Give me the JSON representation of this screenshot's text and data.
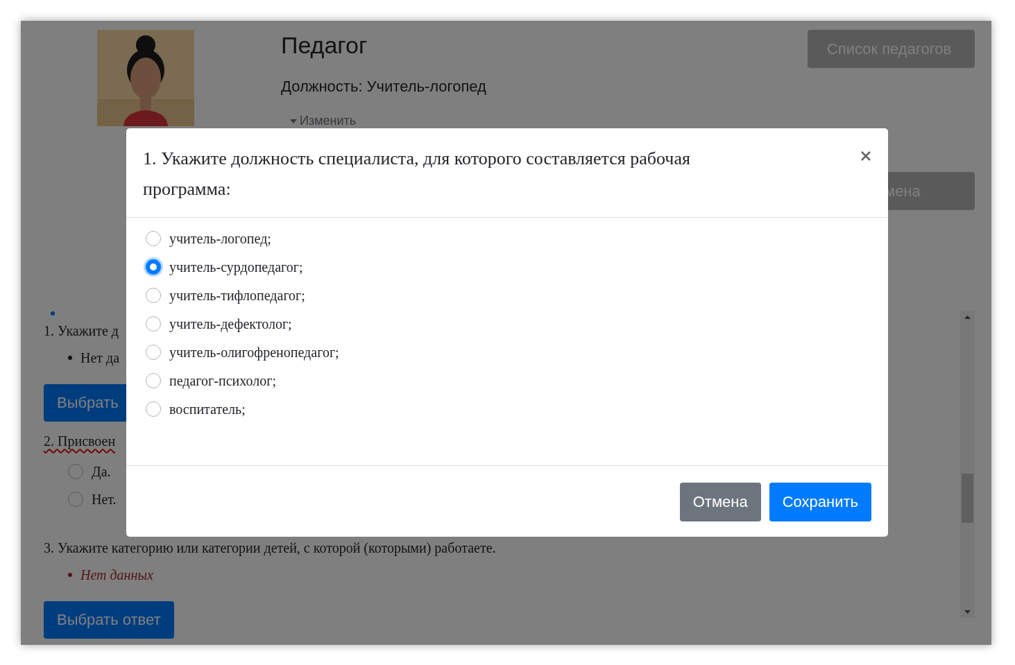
{
  "profile": {
    "kind": "picture",
    "title": "Педагог",
    "position": "Должность: Учитель-логопед",
    "toggle": {
      "label": "Изменить",
      "expanded": false
    }
  },
  "side_buttons": [
    {
      "label": "Список педагогов"
    },
    {
      "label": "мена"
    }
  ],
  "questions": [
    {
      "kind": "list",
      "title": "1. Укажите д",
      "flagged": false,
      "items": [
        {
          "text": "Нет да",
          "missing": false
        }
      ],
      "button": "Выбрать"
    },
    {
      "kind": "radio",
      "title": "2. Присвоен",
      "flagged": true,
      "options": [
        {
          "label": "Да.",
          "selected": false
        },
        {
          "label": "Нет.",
          "selected": false
        }
      ]
    },
    {
      "kind": "list",
      "title": "3. Укажите категорию или категории детей, с которой (которыми) работаете.",
      "flagged": false,
      "items": [
        {
          "text": "Нет данных",
          "missing": true
        }
      ],
      "button": "Выбрать ответ"
    }
  ],
  "modal": {
    "title": "1. Укажите должность специалиста, для которого составляется рабочая программа:",
    "options": [
      {
        "label": "учитель-логопед;",
        "selected": false
      },
      {
        "label": "учитель-сурдопедагог;",
        "selected": true
      },
      {
        "label": "учитель-тифлопедагог;",
        "selected": false
      },
      {
        "label": "учитель-дефектолог;",
        "selected": false
      },
      {
        "label": "учитель-олигофренопедагог;",
        "selected": false
      },
      {
        "label": "педагог-психолог;",
        "selected": false
      },
      {
        "label": "воспитатель;",
        "selected": false
      }
    ],
    "buttons": [
      {
        "label": "Отмена",
        "kind": "secondary"
      },
      {
        "label": "Сохранить",
        "kind": "primary"
      }
    ]
  }
}
